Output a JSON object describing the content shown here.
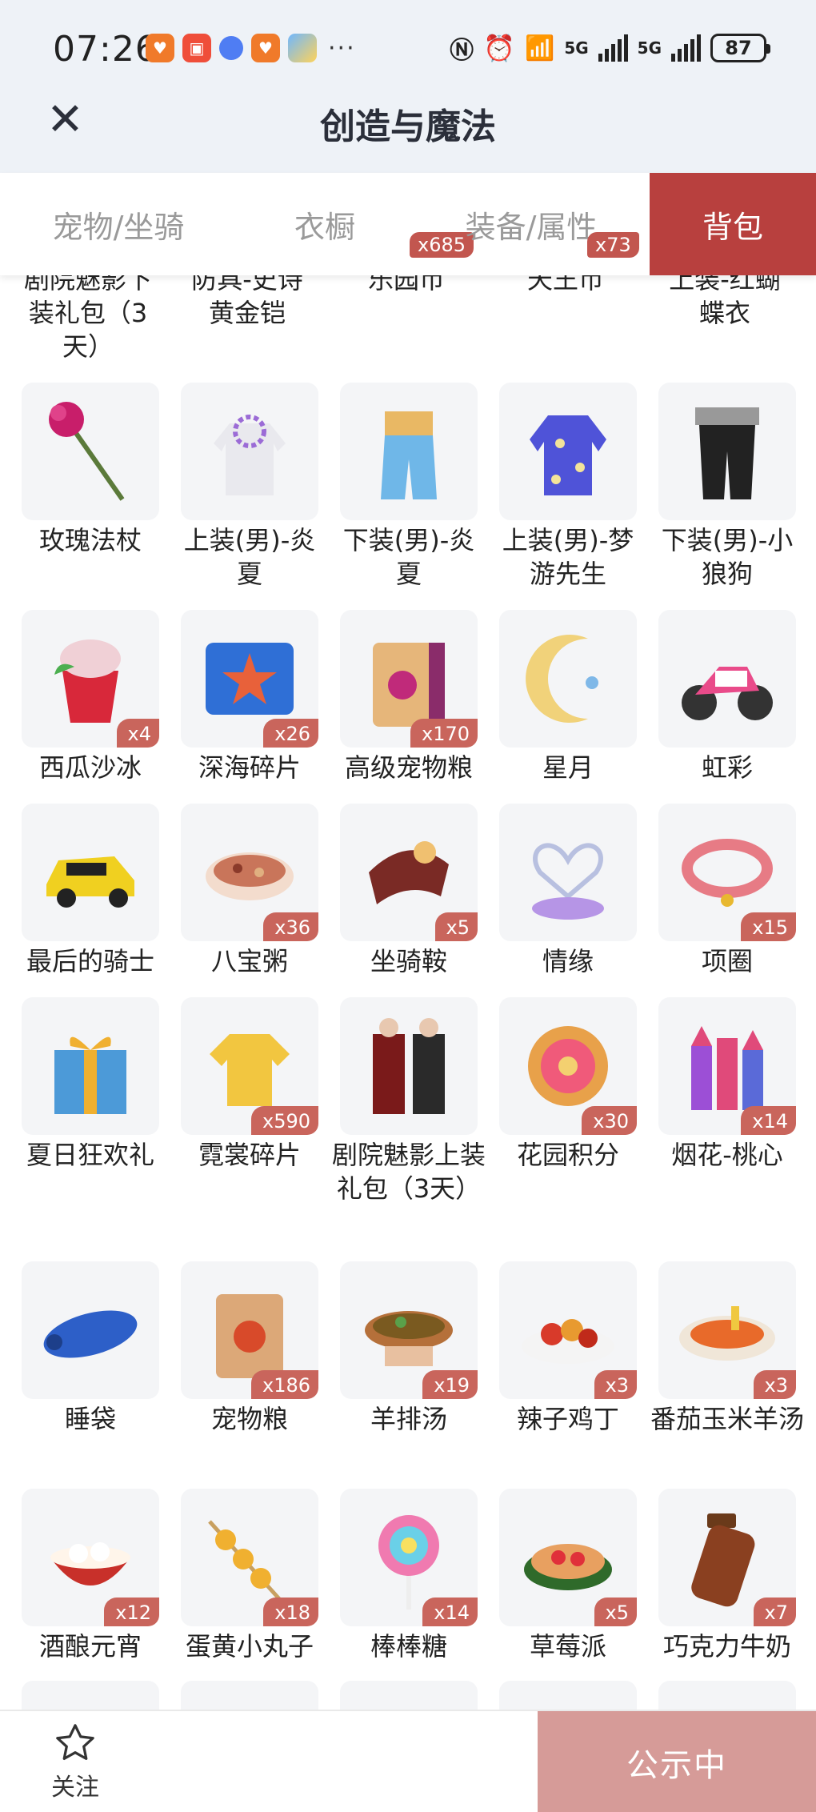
{
  "status_bar": {
    "time": "07:26",
    "more": "···",
    "signal1": "5G",
    "signal2": "5G",
    "battery": "87"
  },
  "header": {
    "title": "创造与魔法"
  },
  "tabs": [
    {
      "label": "宠物/坐骑",
      "active": false,
      "badge": ""
    },
    {
      "label": "衣橱",
      "active": false,
      "badge": "x685"
    },
    {
      "label": "装备/属性",
      "active": false,
      "badge": "x73"
    },
    {
      "label": "背包",
      "active": true,
      "badge": ""
    }
  ],
  "partial_row": {
    "line1": [
      "剧院魅影下",
      "防具-史诗",
      "乐园币",
      "天王币",
      "上装-红蝴"
    ],
    "line2": [
      "装礼包（3",
      "黄金铠",
      "",
      "",
      "蝶衣"
    ],
    "line3": [
      "天）",
      "",
      "",
      "",
      ""
    ]
  },
  "items": [
    {
      "label": "玫瑰法杖",
      "qty": "",
      "icon": "rose-wand-icon"
    },
    {
      "label": "上装(男)-炎夏",
      "qty": "",
      "icon": "summer-top-icon"
    },
    {
      "label": "下装(男)-炎夏",
      "qty": "",
      "icon": "summer-bottom-icon"
    },
    {
      "label": "上装(男)-梦游先生",
      "qty": "",
      "icon": "pajama-top-icon"
    },
    {
      "label": "下装(男)-小狼狗",
      "qty": "",
      "icon": "wolf-pants-icon"
    },
    {
      "label": "西瓜沙冰",
      "qty": "x4",
      "icon": "watermelon-smoothie-icon"
    },
    {
      "label": "深海碎片",
      "qty": "x26",
      "icon": "deep-sea-fragment-icon"
    },
    {
      "label": "高级宠物粮",
      "qty": "x170",
      "icon": "premium-pet-food-icon"
    },
    {
      "label": "星月",
      "qty": "",
      "icon": "star-moon-icon"
    },
    {
      "label": "虹彩",
      "qty": "",
      "icon": "motorcycle-icon"
    },
    {
      "label": "最后的骑士",
      "qty": "",
      "icon": "sports-car-icon"
    },
    {
      "label": "八宝粥",
      "qty": "x36",
      "icon": "congee-icon"
    },
    {
      "label": "坐骑鞍",
      "qty": "x5",
      "icon": "saddle-icon"
    },
    {
      "label": "情缘",
      "qty": "",
      "icon": "heart-lotus-icon"
    },
    {
      "label": "项圈",
      "qty": "x15",
      "icon": "collar-icon"
    },
    {
      "label": "夏日狂欢礼",
      "qty": "",
      "icon": "gift-box-icon"
    },
    {
      "label": "霓裳碎片",
      "qty": "x590",
      "icon": "shirt-fragment-icon"
    },
    {
      "label": "剧院魅影上装礼包（3天）",
      "qty": "",
      "icon": "phantom-costume-icon"
    },
    {
      "label": "花园积分",
      "qty": "x30",
      "icon": "flower-token-icon"
    },
    {
      "label": "烟花-桃心",
      "qty": "x14",
      "icon": "firework-icon"
    },
    {
      "label": "睡袋",
      "qty": "",
      "icon": "sleeping-bag-icon"
    },
    {
      "label": "宠物粮",
      "qty": "x186",
      "icon": "pet-food-icon"
    },
    {
      "label": "羊排汤",
      "qty": "x19",
      "icon": "lamb-soup-icon"
    },
    {
      "label": "辣子鸡丁",
      "qty": "x3",
      "icon": "spicy-chicken-icon"
    },
    {
      "label": "番茄玉米羊汤",
      "qty": "x3",
      "icon": "tomato-corn-soup-icon"
    },
    {
      "label": "酒酿元宵",
      "qty": "x12",
      "icon": "rice-ball-icon"
    },
    {
      "label": "蛋黄小丸子",
      "qty": "x18",
      "icon": "skewer-icon"
    },
    {
      "label": "棒棒糖",
      "qty": "x14",
      "icon": "lollipop-icon"
    },
    {
      "label": "草莓派",
      "qty": "x5",
      "icon": "strawberry-pie-icon"
    },
    {
      "label": "巧克力牛奶",
      "qty": "x7",
      "icon": "chocolate-milk-icon"
    }
  ],
  "bottom": {
    "follow_label": "关注",
    "publish_label": "公示中"
  },
  "colors": {
    "accent": "#b8403e",
    "badge": "#c9655c",
    "publish": "#d69b98",
    "header_bg": "#eef2f7"
  }
}
